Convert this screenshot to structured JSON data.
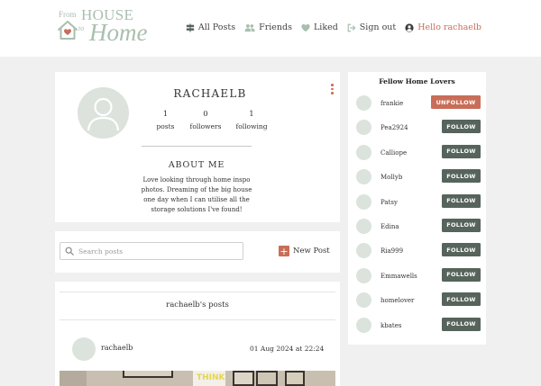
{
  "brand": {
    "from": "From",
    "house": "HOUSE",
    "to": "to",
    "home": "Home",
    "color": "#a9bfae"
  },
  "nav": {
    "all_posts": "All Posts",
    "friends": "Friends",
    "liked": "Liked",
    "sign_out": "Sign out",
    "hello": "Hello rachaelb"
  },
  "profile": {
    "username": "RACHAELB",
    "posts_count": "1",
    "posts_label": "posts",
    "followers_count": "0",
    "followers_label": "followers",
    "following_count": "1",
    "following_label": "following",
    "about_title": "ABOUT ME",
    "about_text": "Love looking through home inspo photos. Dreaming of the big house one day when I can utilise all the storage solutions I've found!"
  },
  "search": {
    "placeholder": "Search posts",
    "new_post_label": "New Post"
  },
  "posts": {
    "title": "rachaelb's posts",
    "items": [
      {
        "author": "rachaelb",
        "date": "01 Aug 2024 at 22:24",
        "image_text": "THINK"
      }
    ]
  },
  "fellow": {
    "title": "Fellow Home Lovers",
    "users": [
      {
        "name": "frankie",
        "action": "UNFOLLOW"
      },
      {
        "name": "Pea2924",
        "action": "FOLLOW"
      },
      {
        "name": "Calliope",
        "action": "FOLLOW"
      },
      {
        "name": "Mollyb",
        "action": "FOLLOW"
      },
      {
        "name": "Patsy",
        "action": "FOLLOW"
      },
      {
        "name": "Edina",
        "action": "FOLLOW"
      },
      {
        "name": "Ria999",
        "action": "FOLLOW"
      },
      {
        "name": "Emmawells",
        "action": "FOLLOW"
      },
      {
        "name": "homelover",
        "action": "FOLLOW"
      },
      {
        "name": "kbates",
        "action": "FOLLOW"
      }
    ]
  },
  "colors": {
    "accent": "#c86e58",
    "follow_button": "#56645c",
    "avatar": "#dbe3dc",
    "background": "#f0f0f0"
  },
  "icons": {
    "all_posts": "signpost-icon",
    "friends": "users-icon",
    "liked": "heart-icon",
    "sign_out": "sign-out-icon",
    "hello": "user-circle-icon",
    "search": "search-icon",
    "new_post": "plus-icon",
    "menu": "kebab-menu-icon"
  }
}
